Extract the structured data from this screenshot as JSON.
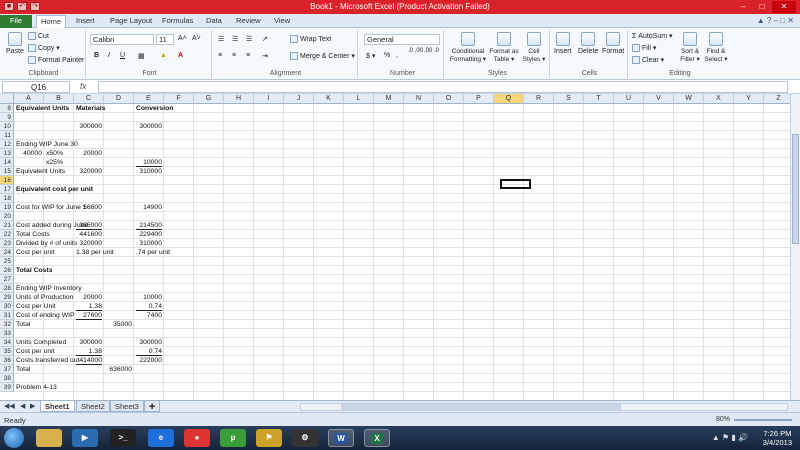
{
  "window": {
    "title": "Book1 - Microsoft Excel (Product Activation Failed)"
  },
  "quick_access": [
    "save-icon",
    "undo-icon",
    "redo-icon"
  ],
  "tabs": [
    {
      "label": "File"
    },
    {
      "label": "Home"
    },
    {
      "label": "Insert"
    },
    {
      "label": "Page Layout"
    },
    {
      "label": "Formulas"
    },
    {
      "label": "Data"
    },
    {
      "label": "Review"
    },
    {
      "label": "View"
    }
  ],
  "ribbon": {
    "clipboard": {
      "paste": "Paste",
      "cut": "Cut",
      "copy": "Copy ▾",
      "format_painter": "Format Painter",
      "label": "Clipboard"
    },
    "font": {
      "name": "Calibri",
      "size": "11",
      "grow": "A˄",
      "shrink": "A˅",
      "bold": "B",
      "italic": "I",
      "underline": "U",
      "label": "Font"
    },
    "alignment": {
      "wrap_text": "Wrap Text",
      "merge_center": "Merge & Center ▾",
      "label": "Alignment"
    },
    "number": {
      "format": "General",
      "currency": "$ ▾",
      "percent": "%",
      "comma": ",",
      "inc_decimal": ".0 .00",
      "dec_decimal": ".00 .0",
      "label": "Number"
    },
    "styles": {
      "conditional": "Conditional Formatting ▾",
      "format_table": "Format as Table ▾",
      "cell_styles": "Cell Styles ▾",
      "label": "Styles"
    },
    "cells": {
      "insert": "Insert",
      "delete": "Delete",
      "format": "Format",
      "label": "Cells"
    },
    "editing": {
      "autosum": "AutoSum ▾",
      "fill": "Fill ▾",
      "clear": "Clear ▾",
      "sort_filter": "Sort & Filter ▾",
      "find_select": "Find & Select ▾",
      "label": "Editing"
    }
  },
  "formula_bar": {
    "name_box": "Q16",
    "fx": "fx",
    "value": ""
  },
  "columns": [
    "A",
    "B",
    "C",
    "D",
    "E",
    "F",
    "G",
    "H",
    "I",
    "J",
    "K",
    "L",
    "M",
    "N",
    "O",
    "P",
    "Q",
    "R",
    "S",
    "T",
    "U",
    "V",
    "W",
    "X",
    "Y",
    "Z"
  ],
  "rows": [
    "8",
    "9",
    "10",
    "11",
    "12",
    "13",
    "14",
    "15",
    "16",
    "17",
    "18",
    "19",
    "20",
    "21",
    "22",
    "23",
    "24",
    "25",
    "26",
    "27",
    "28",
    "29",
    "30",
    "31",
    "32",
    "33",
    "34",
    "35",
    "36",
    "37",
    "38",
    "39"
  ],
  "cells": {
    "r8": {
      "a": "Equivalent Units",
      "c": "Materials",
      "e": "Conversion"
    },
    "r10": {
      "c": "300000",
      "e": "300000"
    },
    "r12": {
      "a": "Ending WIP June 30"
    },
    "r13": {
      "a": "40000",
      "b": "x50%",
      "c": "20000"
    },
    "r14": {
      "b": "x25%",
      "e": "10000"
    },
    "r15": {
      "a": "Equivalent Units",
      "c": "320000",
      "e": "310000"
    },
    "r17": {
      "a": "Equivalent cost per unit"
    },
    "r19": {
      "a": "Cost for WIP for June 1",
      "c": "56600",
      "e": "14900"
    },
    "r21": {
      "a": "Cost added during June",
      "c": "385000",
      "e": "214500"
    },
    "r22": {
      "a": "Total Costs",
      "c": "441600",
      "e": "229400"
    },
    "r23": {
      "a": "Divided by # of units",
      "c": "320000",
      "e": "310000"
    },
    "r24": {
      "a": "Cost per unit",
      "c": "1.38 per unit",
      "e": ".74 per unit"
    },
    "r26": {
      "a": "Total Costs"
    },
    "r28": {
      "a": "Ending WIP Inventory"
    },
    "r29": {
      "a": "Units of Production",
      "c": "20000",
      "e": "10000"
    },
    "r30": {
      "a": "Cost per Unit",
      "c": "1.38",
      "e": "0.74"
    },
    "r31": {
      "a": "Cost of ending WIP",
      "c": "27600",
      "e": "7400"
    },
    "r32": {
      "a": "Total",
      "d": "35000"
    },
    "r34": {
      "a": "Units Completed",
      "c": "300000",
      "e": "300000"
    },
    "r35": {
      "a": "Cost per unit",
      "c": "1.38",
      "e": "0.74"
    },
    "r36": {
      "a": "Costs transferred out",
      "c": "414000",
      "e": "222000"
    },
    "r37": {
      "a": "Total",
      "d": "636000"
    },
    "r39": {
      "a": "Problem 4-13"
    }
  },
  "sheets": [
    {
      "label": "Sheet1"
    },
    {
      "label": "Sheet2"
    },
    {
      "label": "Sheet3"
    }
  ],
  "status": {
    "ready": "Ready",
    "zoom": "80%"
  },
  "taskbar": {
    "apps": [
      "file-explorer",
      "media-player",
      "command-prompt",
      "internet-explorer",
      "chrome",
      "utorrent",
      "windows-security",
      "steam",
      "word",
      "excel"
    ],
    "time": "7:26 PM",
    "date": "3/4/2013"
  },
  "colors": {
    "title_bar": "#d9232a",
    "file_tab": "#2e7d32",
    "selection_header": "#f5d57c"
  }
}
